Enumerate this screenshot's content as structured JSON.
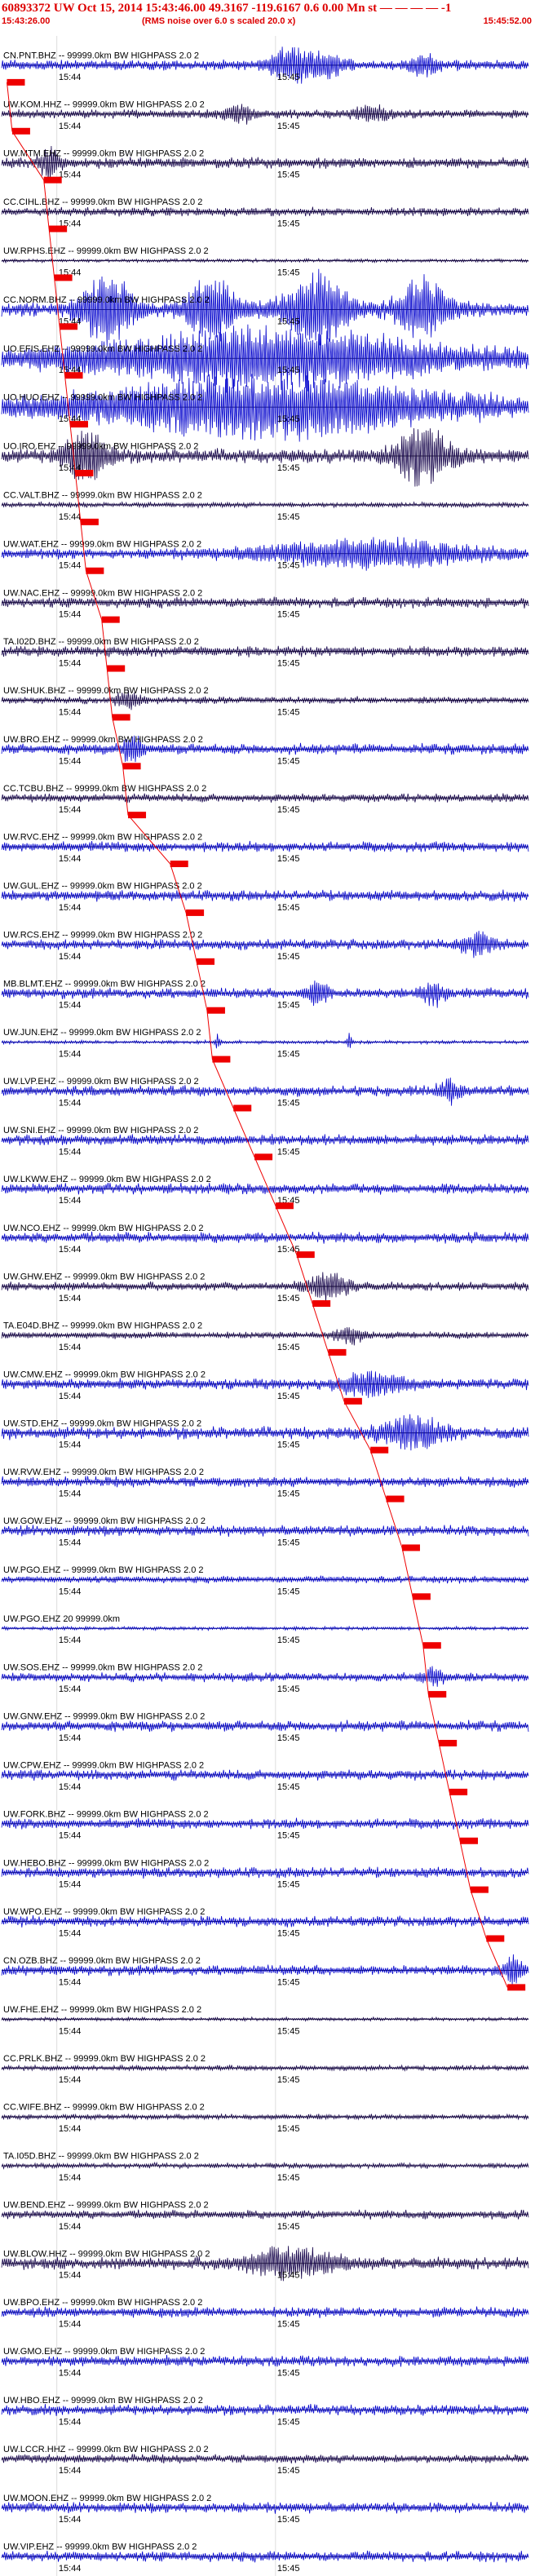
{
  "header": {
    "title": "60893372 UW Oct 15, 2014 15:43:46.00   49.3167  -119.6167   0.6 0.00 Mn st  — — — —  -1",
    "start_time": "15:43:26.00",
    "noise_note": "(RMS noise over 6.0 s scaled 20.0 x)",
    "end_time": "15:45:52.00"
  },
  "tick_labels": {
    "minute_1": "15:44",
    "minute_2": "15:45"
  },
  "colors": {
    "trace_a": "#0000cc",
    "trace_b": "#120048",
    "pick": "#ee0000",
    "baseline": "#000000"
  },
  "traces": [
    {
      "label": "CN.PNT.BHZ -- 99999.0km BW  HIGHPASS  2.0  2",
      "color": "a",
      "amp": 0.3,
      "pick": 0.01,
      "bursts": [
        [
          0.55,
          0.04,
          2.5
        ],
        [
          0.62,
          0.03,
          1.6
        ],
        [
          0.8,
          0.03,
          1.4
        ]
      ]
    },
    {
      "label": "UW.KOM.HHZ -- 99999.0km BW  HIGHPASS  2.0  2",
      "color": "b",
      "amp": 0.25,
      "pick": 0.02,
      "bursts": [
        [
          0.45,
          0.03,
          1.6
        ],
        [
          0.7,
          0.03,
          1.4
        ]
      ]
    },
    {
      "label": "UW.MTM.EHZ -- 99999.0km BW  HIGHPASS  2.0  2",
      "color": "b",
      "amp": 0.3,
      "pick": 0.08,
      "bursts": [
        [
          0.09,
          0.02,
          2.0
        ]
      ]
    },
    {
      "label": "CC.CIHL.BHZ -- 99999.0km BW  HIGHPASS  2.0  2",
      "color": "b",
      "amp": 0.25,
      "pick": 0.09,
      "bursts": []
    },
    {
      "label": "UW.RPHS.EHZ -- 99999.0km BW  HIGHPASS  2.0  2",
      "color": "b",
      "amp": 0.1,
      "pick": 0.1,
      "bursts": []
    },
    {
      "label": "CC.NORM.BHZ -- 99999.0km BW  HIGHPASS  2.0  2",
      "color": "a",
      "amp": 0.4,
      "pick": 0.11,
      "bursts": [
        [
          0.2,
          0.05,
          4.0
        ],
        [
          0.4,
          0.05,
          3.5
        ],
        [
          0.6,
          0.06,
          4.0
        ],
        [
          0.8,
          0.05,
          3.5
        ]
      ]
    },
    {
      "label": "UO.EFIS.EHZ -- 99999.0km BW  HIGHPASS  2.0  2",
      "color": "a",
      "amp": 0.6,
      "pick": 0.12,
      "bursts": [
        [
          0.5,
          0.3,
          2.0
        ]
      ]
    },
    {
      "label": "UO.HUO.EHZ -- 99999.0km BW  HIGHPASS  2.0  2",
      "color": "a",
      "amp": 0.6,
      "pick": 0.13,
      "bursts": [
        [
          0.5,
          0.3,
          2.0
        ]
      ]
    },
    {
      "label": "UO.IRO.EHZ -- 99999.0km BW  HIGHPASS  2.0  2",
      "color": "b",
      "amp": 0.4,
      "pick": 0.14,
      "bursts": [
        [
          0.16,
          0.04,
          3.0
        ],
        [
          0.8,
          0.05,
          3.5
        ]
      ]
    },
    {
      "label": "CC.VALT.BHZ -- 99999.0km BW  HIGHPASS  2.0  2",
      "color": "b",
      "amp": 0.15,
      "pick": 0.15,
      "bursts": []
    },
    {
      "label": "UW.WAT.EHZ -- 99999.0km BW  HIGHPASS  2.0  2",
      "color": "a",
      "amp": 0.3,
      "pick": 0.16,
      "bursts": [
        [
          0.7,
          0.2,
          2.0
        ]
      ]
    },
    {
      "label": "UW.NAC.EHZ -- 99999.0km BW  HIGHPASS  2.0  2",
      "color": "b",
      "amp": 0.3,
      "pick": 0.19,
      "bursts": []
    },
    {
      "label": "TA.I02D.BHZ -- 99999.0km BW  HIGHPASS  2.0  2",
      "color": "b",
      "amp": 0.3,
      "pick": 0.2,
      "bursts": []
    },
    {
      "label": "UW.SHUK.BHZ -- 99999.0km BW  HIGHPASS  2.0  2",
      "color": "b",
      "amp": 0.2,
      "pick": 0.21,
      "bursts": [
        [
          0.24,
          0.02,
          2.5
        ]
      ]
    },
    {
      "label": "UW.BRO.EHZ -- 99999.0km BW  HIGHPASS  2.0  2",
      "color": "a",
      "amp": 0.3,
      "pick": 0.23,
      "bursts": [
        [
          0.25,
          0.02,
          2.0
        ]
      ]
    },
    {
      "label": "CC.TCBU.BHZ -- 99999.0km BW  HIGHPASS  2.0  2",
      "color": "b",
      "amp": 0.25,
      "pick": 0.24,
      "bursts": []
    },
    {
      "label": "UW.RVC.EHZ -- 99999.0km BW  HIGHPASS  2.0  2",
      "color": "a",
      "amp": 0.3,
      "pick": 0.32,
      "bursts": []
    },
    {
      "label": "UW.GUL.EHZ -- 99999.0km BW  HIGHPASS  2.0  2",
      "color": "a",
      "amp": 0.3,
      "pick": 0.35,
      "bursts": []
    },
    {
      "label": "UW.RCS.EHZ -- 99999.0km BW  HIGHPASS  2.0  2",
      "color": "a",
      "amp": 0.3,
      "pick": 0.37,
      "bursts": [
        [
          0.9,
          0.03,
          1.6
        ]
      ]
    },
    {
      "label": "MB.BLMT.EHZ -- 99999.0km BW  HIGHPASS  2.0  2",
      "color": "a",
      "amp": 0.3,
      "pick": 0.39,
      "bursts": [
        [
          0.6,
          0.02,
          1.8
        ],
        [
          0.82,
          0.02,
          1.8
        ]
      ]
    },
    {
      "label": "UW.JUN.EHZ -- 99999.0km BW  HIGHPASS  2.0  2",
      "color": "a",
      "amp": 0.1,
      "pick": 0.4,
      "bursts": [
        [
          0.41,
          0.005,
          4.0
        ],
        [
          0.66,
          0.005,
          4.0
        ]
      ]
    },
    {
      "label": "UW.LVP.EHZ -- 99999.0km BW  HIGHPASS  2.0  2",
      "color": "a",
      "amp": 0.3,
      "pick": 0.44,
      "bursts": [
        [
          0.85,
          0.02,
          1.6
        ]
      ]
    },
    {
      "label": "UW.SNI.EHZ -- 99999.0km BW  HIGHPASS  2.0  2",
      "color": "a",
      "amp": 0.3,
      "pick": 0.48,
      "bursts": []
    },
    {
      "label": "UW.LKWW.EHZ -- 99999.0km BW  HIGHPASS  2.0  2",
      "color": "a",
      "amp": 0.3,
      "pick": 0.52,
      "bursts": []
    },
    {
      "label": "UW.NCO.EHZ -- 99999.0km BW  HIGHPASS  2.0  2",
      "color": "a",
      "amp": 0.3,
      "pick": 0.56,
      "bursts": []
    },
    {
      "label": "UW.GHW.EHZ -- 99999.0km BW  HIGHPASS  2.0  2",
      "color": "b",
      "amp": 0.25,
      "pick": 0.59,
      "bursts": [
        [
          0.62,
          0.04,
          2.5
        ]
      ]
    },
    {
      "label": "TA.E04D.BHZ -- 99999.0km BW  HIGHPASS  2.0  2",
      "color": "b",
      "amp": 0.2,
      "pick": 0.62,
      "bursts": [
        [
          0.66,
          0.03,
          1.8
        ]
      ]
    },
    {
      "label": "UW.CMW.EHZ -- 99999.0km BW  HIGHPASS  2.0  2",
      "color": "a",
      "amp": 0.3,
      "pick": 0.65,
      "bursts": [
        [
          0.7,
          0.06,
          1.6
        ]
      ]
    },
    {
      "label": "UW.STD.EHZ -- 99999.0km BW  HIGHPASS  2.0  2",
      "color": "a",
      "amp": 0.35,
      "pick": 0.7,
      "bursts": [
        [
          0.78,
          0.06,
          2.0
        ]
      ]
    },
    {
      "label": "UW.RVW.EHZ -- 99999.0km BW  HIGHPASS  2.0  2",
      "color": "a",
      "amp": 0.3,
      "pick": 0.73,
      "bursts": []
    },
    {
      "label": "UW.GOW.EHZ -- 99999.0km BW  HIGHPASS  2.0  2",
      "color": "a",
      "amp": 0.3,
      "pick": 0.76,
      "bursts": []
    },
    {
      "label": "UW.PGO.EHZ -- 99999.0km BW  HIGHPASS  2.0  2",
      "color": "a",
      "amp": 0.2,
      "pick": 0.78,
      "bursts": []
    },
    {
      "label": "UW.PGO.EHZ 20 99999.0km",
      "color": "a",
      "amp": 0.1,
      "pick": 0.8,
      "bursts": []
    },
    {
      "label": "UW.SOS.EHZ -- 99999.0km BW  HIGHPASS  2.0  2",
      "color": "a",
      "amp": 0.25,
      "pick": 0.81,
      "bursts": [
        [
          0.82,
          0.02,
          1.8
        ]
      ]
    },
    {
      "label": "UW.GNW.EHZ -- 99999.0km BW  HIGHPASS  2.0  2",
      "color": "a",
      "amp": 0.3,
      "pick": 0.83,
      "bursts": []
    },
    {
      "label": "UW.CPW.EHZ -- 99999.0km BW  HIGHPASS  2.0  2",
      "color": "a",
      "amp": 0.3,
      "pick": 0.85,
      "bursts": []
    },
    {
      "label": "UW.FORK.BHZ -- 99999.0km BW  HIGHPASS  2.0  2",
      "color": "a",
      "amp": 0.3,
      "pick": 0.87,
      "bursts": []
    },
    {
      "label": "UW.HEBO.BHZ -- 99999.0km BW  HIGHPASS  2.0  2",
      "color": "a",
      "amp": 0.3,
      "pick": 0.89,
      "bursts": []
    },
    {
      "label": "UW.WPO.EHZ -- 99999.0km BW  HIGHPASS  2.0  2",
      "color": "a",
      "amp": 0.3,
      "pick": 0.92,
      "bursts": []
    },
    {
      "label": "CN.OZB.BHZ -- 99999.0km BW  HIGHPASS  2.0  2",
      "color": "a",
      "amp": 0.3,
      "pick": 0.96,
      "bursts": [
        [
          0.97,
          0.02,
          1.8
        ]
      ]
    },
    {
      "label": "UW.FHE.EHZ -- 99999.0km BW  HIGHPASS  2.0  2",
      "color": "b",
      "amp": 0.1,
      "pick": null,
      "bursts": []
    },
    {
      "label": "CC.PRLK.BHZ -- 99999.0km BW  HIGHPASS  2.0  2",
      "color": "b",
      "amp": 0.15,
      "pick": null,
      "bursts": []
    },
    {
      "label": "CC.WIFE.BHZ -- 99999.0km BW  HIGHPASS  2.0  2",
      "color": "b",
      "amp": 0.15,
      "pick": null,
      "bursts": []
    },
    {
      "label": "TA.I05D.BHZ -- 99999.0km BW  HIGHPASS  2.0  2",
      "color": "b",
      "amp": 0.15,
      "pick": null,
      "bursts": []
    },
    {
      "label": "UW.BEND.EHZ -- 99999.0km BW  HIGHPASS  2.0  2",
      "color": "b",
      "amp": 0.25,
      "pick": null,
      "bursts": []
    },
    {
      "label": "UW.BLOW.HHZ -- 99999.0km BW  HIGHPASS  2.0  2",
      "color": "b",
      "amp": 0.35,
      "pick": null,
      "bursts": [
        [
          0.55,
          0.08,
          2.0
        ]
      ]
    },
    {
      "label": "UW.BPO.EHZ -- 99999.0km BW  HIGHPASS  2.0  2",
      "color": "a",
      "amp": 0.3,
      "pick": null,
      "bursts": []
    },
    {
      "label": "UW.GMO.EHZ -- 99999.0km BW  HIGHPASS  2.0  2",
      "color": "a",
      "amp": 0.3,
      "pick": null,
      "bursts": []
    },
    {
      "label": "UW.HBO.EHZ -- 99999.0km BW  HIGHPASS  2.0  2",
      "color": "a",
      "amp": 0.3,
      "pick": null,
      "bursts": []
    },
    {
      "label": "UW.LCCR.HHZ -- 99999.0km BW  HIGHPASS  2.0  2",
      "color": "b",
      "amp": 0.25,
      "pick": null,
      "bursts": []
    },
    {
      "label": "UW.MOON.EHZ -- 99999.0km BW  HIGHPASS  2.0  2",
      "color": "a",
      "amp": 0.3,
      "pick": null,
      "bursts": []
    },
    {
      "label": "UW.VIP.EHZ -- 99999.0km BW  HIGHPASS  2.0  2",
      "color": "a",
      "amp": 0.3,
      "pick": null,
      "bursts": []
    }
  ]
}
